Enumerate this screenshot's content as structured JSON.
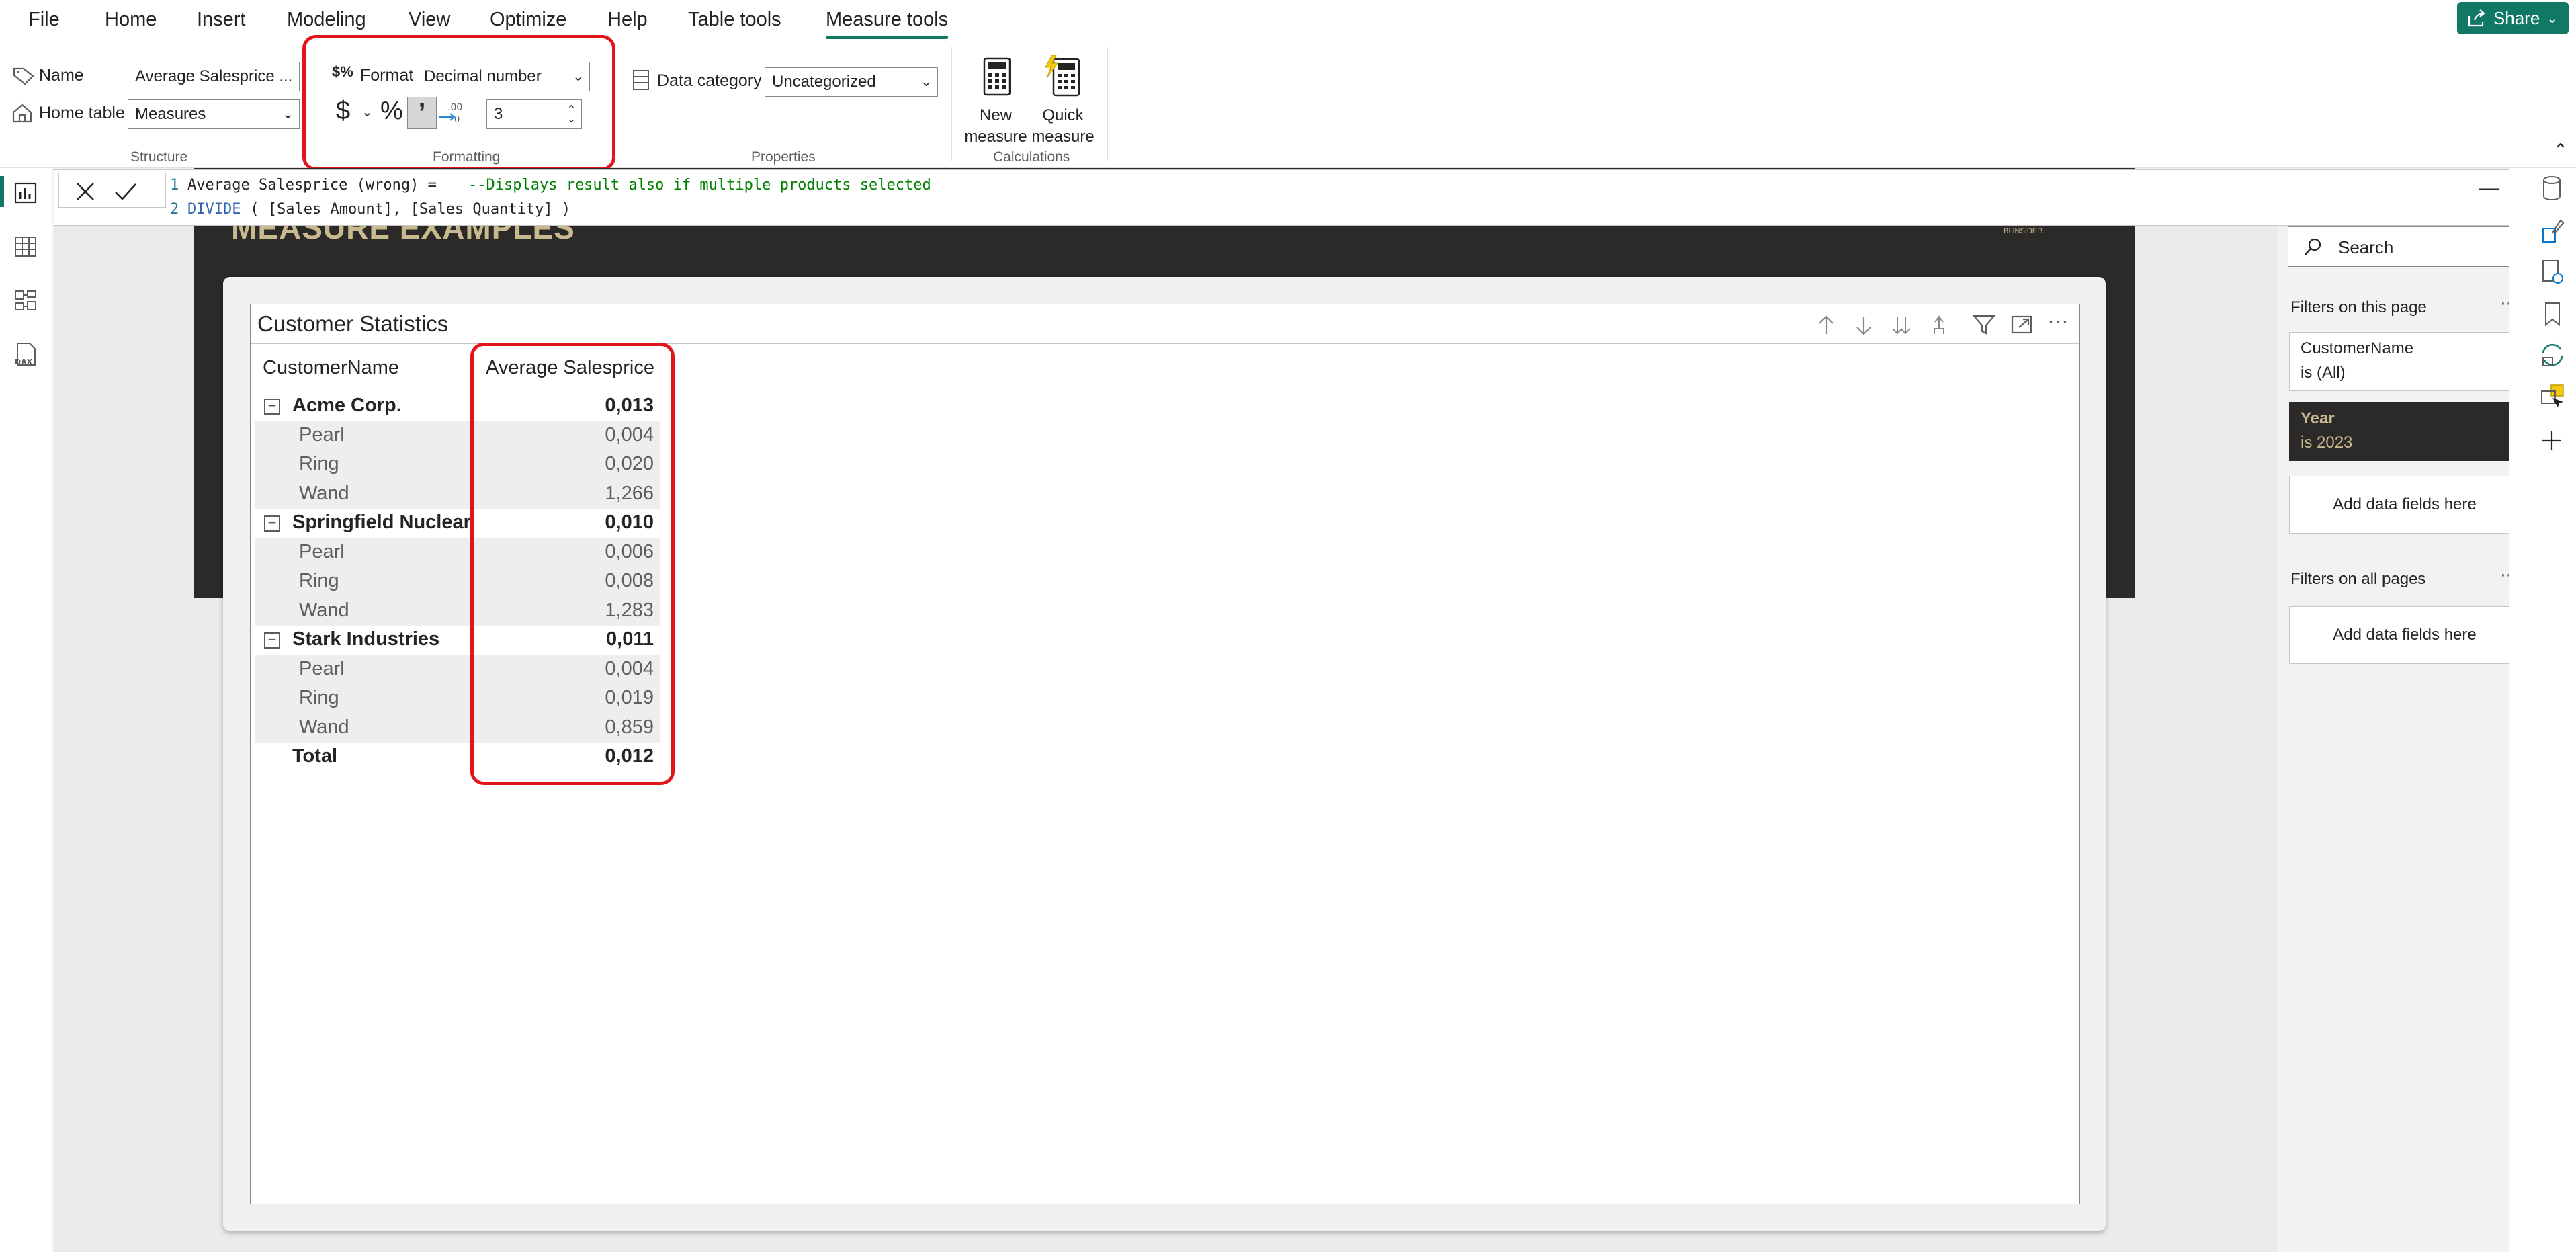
{
  "menu": {
    "items": [
      "File",
      "Home",
      "Insert",
      "Modeling",
      "View",
      "Optimize",
      "Help",
      "Table tools",
      "Measure tools"
    ],
    "active": "Measure tools",
    "share_label": "Share"
  },
  "ribbon": {
    "structure": {
      "name_label": "Name",
      "name_value": "Average Salesprice ...",
      "home_table_label": "Home table",
      "home_table_value": "Measures",
      "group_label": "Structure"
    },
    "formatting": {
      "format_label": "Format",
      "format_value": "Decimal number",
      "currency_symbol": "$",
      "percent_symbol": "%",
      "comma_symbol": "’",
      "decimals_value": "3",
      "group_label": "Formatting"
    },
    "properties": {
      "data_category_label": "Data category",
      "data_category_value": "Uncategorized",
      "group_label": "Properties"
    },
    "calculations": {
      "new_measure_line1": "New",
      "new_measure_line2": "measure",
      "quick_measure_line1": "Quick",
      "quick_measure_line2": "measure",
      "group_label": "Calculations"
    }
  },
  "formula": {
    "line1_num": "1",
    "line1_name": "Average Salesprice (wrong) = ",
    "line1_comment": "--Displays result also if multiple products selected",
    "line2_num": "2",
    "line2_func": "DIVIDE",
    "line2_rest": " ( [Sales Amount], [Sales Quantity] )"
  },
  "report": {
    "page_title": "MEASURE EXAMPLES",
    "brand": "BI INSIDER",
    "visual_title": "Customer Statistics",
    "columns": [
      "CustomerName",
      "Average Salesprice"
    ],
    "rows": [
      {
        "label": "Acme Corp.",
        "value": "0,013",
        "level": 0
      },
      {
        "label": "Pearl",
        "value": "0,004",
        "level": 1
      },
      {
        "label": "Ring",
        "value": "0,020",
        "level": 1
      },
      {
        "label": "Wand",
        "value": "1,266",
        "level": 1
      },
      {
        "label": "Springfield Nuclear",
        "value": "0,010",
        "level": 0
      },
      {
        "label": "Pearl",
        "value": "0,006",
        "level": 1
      },
      {
        "label": "Ring",
        "value": "0,008",
        "level": 1
      },
      {
        "label": "Wand",
        "value": "1,283",
        "level": 1
      },
      {
        "label": "Stark Industries",
        "value": "0,011",
        "level": 0
      },
      {
        "label": "Pearl",
        "value": "0,004",
        "level": 1
      },
      {
        "label": "Ring",
        "value": "0,019",
        "level": 1
      },
      {
        "label": "Wand",
        "value": "0,859",
        "level": 1
      },
      {
        "label": "Total",
        "value": "0,012",
        "level": "total"
      }
    ]
  },
  "filters": {
    "search_placeholder": "Search",
    "on_this_page": "Filters on this page",
    "filter1_field": "CustomerName",
    "filter1_value": "is (All)",
    "filter2_field": "Year",
    "filter2_value": "is 2023",
    "add_fields": "Add data fields here",
    "on_all_pages": "Filters on all pages",
    "add_fields_all": "Add data fields here"
  },
  "colors": {
    "accent": "#117865",
    "highlight": "#e3151c",
    "dark_header": "#2b2a29",
    "gold_text": "#c8b98f"
  }
}
